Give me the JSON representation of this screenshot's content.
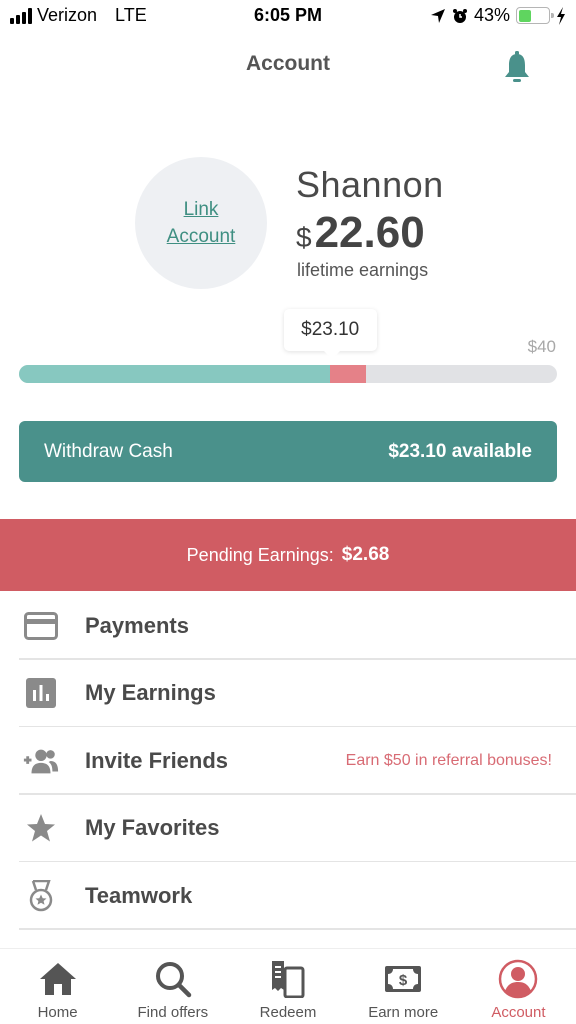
{
  "status_bar": {
    "carrier": "Verizon",
    "network": "LTE",
    "time": "6:05 PM",
    "battery_percent_label": "43%",
    "battery_level": 0.43
  },
  "header": {
    "title": "Account"
  },
  "profile": {
    "link_account_line1": "Link",
    "link_account_line2": "Account",
    "name": "Shannon",
    "currency_symbol": "$",
    "lifetime_earnings": "22.60",
    "lifetime_label": "lifetime earnings"
  },
  "progress": {
    "current_label": "$23.10",
    "goal_label": "$40",
    "available_value": 23.1,
    "pending_value": 2.68,
    "goal_value": 40
  },
  "withdraw": {
    "label": "Withdraw Cash",
    "amount_label": "$23.10 available"
  },
  "pending": {
    "label": "Pending Earnings:",
    "amount": "$2.68"
  },
  "menu": {
    "items": [
      {
        "label": "Payments",
        "icon": "credit-card-icon"
      },
      {
        "label": "My Earnings",
        "icon": "bar-chart-icon"
      },
      {
        "label": "Invite Friends",
        "icon": "add-people-icon",
        "extra": "Earn $50 in referral bonuses!"
      },
      {
        "label": "My Favorites",
        "icon": "star-icon"
      },
      {
        "label": "Teamwork",
        "icon": "medal-icon"
      }
    ]
  },
  "tabs": [
    {
      "label": "Home",
      "icon": "home-icon"
    },
    {
      "label": "Find offers",
      "icon": "search-icon"
    },
    {
      "label": "Redeem",
      "icon": "receipt-phone-icon"
    },
    {
      "label": "Earn more",
      "icon": "cash-icon"
    },
    {
      "label": "Account",
      "icon": "account-icon",
      "active": true
    }
  ],
  "colors": {
    "accent_teal": "#4a918b",
    "progress_teal": "#87c8c0",
    "pending_red": "#d05c63",
    "pending_bar": "#e58188",
    "referral_text": "#d86b74"
  }
}
